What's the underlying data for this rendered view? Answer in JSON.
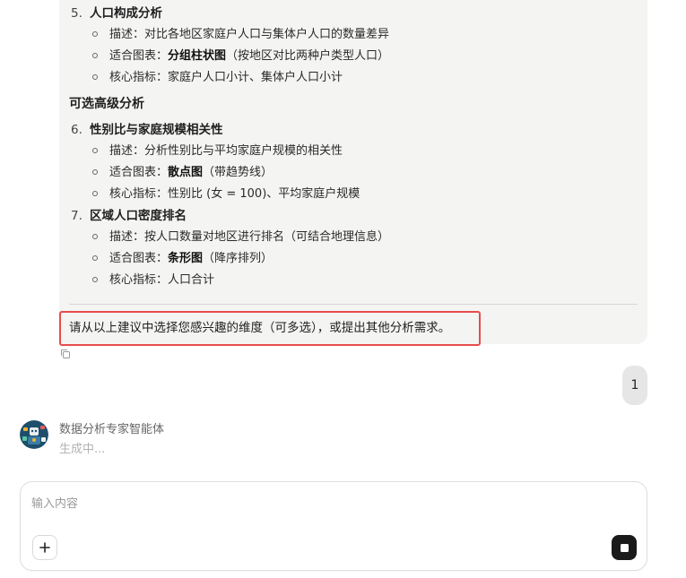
{
  "message": {
    "items": [
      {
        "number": "5.",
        "title": "人口构成分析",
        "bullets": [
          {
            "prefix": "描述：",
            "bold": "",
            "rest": "对比各地区家庭户人口与集体户人口的数量差异"
          },
          {
            "prefix": "适合图表：",
            "bold": "分组柱状图",
            "rest": "（按地区对比两种户类型人口）"
          },
          {
            "prefix": "核心指标：",
            "bold": "",
            "rest": "家庭户人口小计、集体户人口小计"
          }
        ]
      },
      {
        "number": "6.",
        "title": "性别比与家庭规模相关性",
        "bullets": [
          {
            "prefix": "描述：",
            "bold": "",
            "rest": "分析性别比与平均家庭户规模的相关性"
          },
          {
            "prefix": "适合图表：",
            "bold": "散点图",
            "rest": "（带趋势线）"
          },
          {
            "prefix": "核心指标：",
            "bold": "",
            "rest": "性别比 (女 = 100)、平均家庭户规模"
          }
        ]
      },
      {
        "number": "7.",
        "title": "区域人口密度排名",
        "bullets": [
          {
            "prefix": "描述：",
            "bold": "",
            "rest": "按人口数量对地区进行排名（可结合地理信息）"
          },
          {
            "prefix": "适合图表：",
            "bold": "条形图",
            "rest": "（降序排列）"
          },
          {
            "prefix": "核心指标：",
            "bold": "",
            "rest": "人口合计"
          }
        ]
      }
    ],
    "section_title": "可选高级分析",
    "question": "请从以上建议中选择您感兴趣的维度（可多选），或提出其他分析需求。"
  },
  "user_message": "1",
  "agent": {
    "name": "数据分析专家智能体",
    "status": "生成中..."
  },
  "composer": {
    "placeholder": "输入内容",
    "add_label": "+"
  }
}
